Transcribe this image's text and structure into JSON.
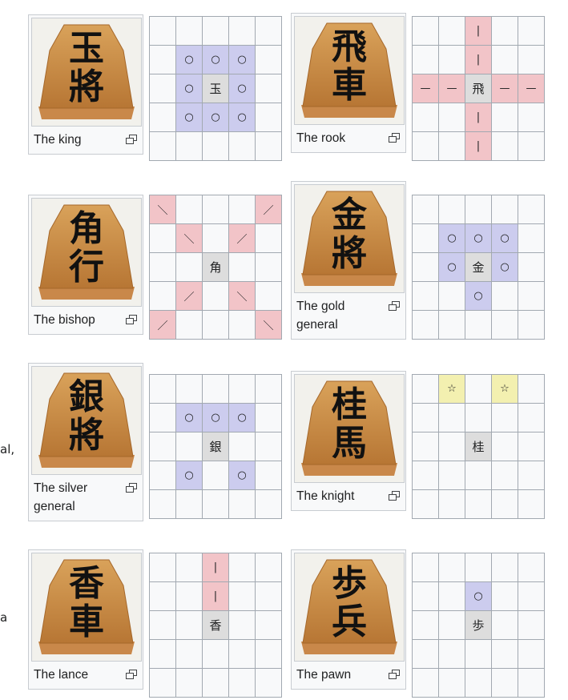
{
  "article_text_fragments": [
    {
      "id": "f1",
      "text": "al,"
    },
    {
      "id": "f2",
      "text": "a"
    }
  ],
  "colors": {
    "move_step": "#ccccee",
    "move_range": "#f2c4c8",
    "move_jump": "#f3f0b0",
    "piece_square": "#dddddd",
    "board_bg": "#f8f9fa",
    "grid_line": "#a2a9b1"
  },
  "icons": {
    "enlarge": "magnify-clip-icon"
  },
  "pieces": [
    {
      "key": "king",
      "caption": "The king",
      "kanji_top": "玉",
      "kanji_bottom": "將",
      "board": [
        {
          "row": 1,
          "col": 1,
          "mark": "○",
          "type": "blue"
        },
        {
          "row": 1,
          "col": 2,
          "mark": "○",
          "type": "blue"
        },
        {
          "row": 1,
          "col": 3,
          "mark": "○",
          "type": "blue"
        },
        {
          "row": 2,
          "col": 1,
          "mark": "○",
          "type": "blue"
        },
        {
          "row": 2,
          "col": 2,
          "mark": "玉",
          "type": "center"
        },
        {
          "row": 2,
          "col": 3,
          "mark": "○",
          "type": "blue"
        },
        {
          "row": 3,
          "col": 1,
          "mark": "○",
          "type": "blue"
        },
        {
          "row": 3,
          "col": 2,
          "mark": "○",
          "type": "blue"
        },
        {
          "row": 3,
          "col": 3,
          "mark": "○",
          "type": "blue"
        }
      ]
    },
    {
      "key": "rook",
      "caption": "The rook",
      "kanji_top": "飛",
      "kanji_bottom": "車",
      "board": [
        {
          "row": 0,
          "col": 2,
          "mark": "|",
          "type": "pink"
        },
        {
          "row": 1,
          "col": 2,
          "mark": "|",
          "type": "pink"
        },
        {
          "row": 2,
          "col": 0,
          "mark": "—",
          "type": "pink"
        },
        {
          "row": 2,
          "col": 1,
          "mark": "—",
          "type": "pink"
        },
        {
          "row": 2,
          "col": 2,
          "mark": "飛",
          "type": "center"
        },
        {
          "row": 2,
          "col": 3,
          "mark": "—",
          "type": "pink"
        },
        {
          "row": 2,
          "col": 4,
          "mark": "—",
          "type": "pink"
        },
        {
          "row": 3,
          "col": 2,
          "mark": "|",
          "type": "pink"
        },
        {
          "row": 4,
          "col": 2,
          "mark": "|",
          "type": "pink"
        }
      ]
    },
    {
      "key": "bishop",
      "caption": "The bishop",
      "kanji_top": "角",
      "kanji_bottom": "行",
      "board": [
        {
          "row": 0,
          "col": 0,
          "mark": "＼",
          "type": "pink"
        },
        {
          "row": 0,
          "col": 4,
          "mark": "／",
          "type": "pink"
        },
        {
          "row": 1,
          "col": 1,
          "mark": "＼",
          "type": "pink"
        },
        {
          "row": 1,
          "col": 3,
          "mark": "／",
          "type": "pink"
        },
        {
          "row": 2,
          "col": 2,
          "mark": "角",
          "type": "center"
        },
        {
          "row": 3,
          "col": 1,
          "mark": "／",
          "type": "pink"
        },
        {
          "row": 3,
          "col": 3,
          "mark": "＼",
          "type": "pink"
        },
        {
          "row": 4,
          "col": 0,
          "mark": "／",
          "type": "pink"
        },
        {
          "row": 4,
          "col": 4,
          "mark": "＼",
          "type": "pink"
        }
      ]
    },
    {
      "key": "gold",
      "caption": "The gold general",
      "kanji_top": "金",
      "kanji_bottom": "將",
      "board": [
        {
          "row": 1,
          "col": 1,
          "mark": "○",
          "type": "blue"
        },
        {
          "row": 1,
          "col": 2,
          "mark": "○",
          "type": "blue"
        },
        {
          "row": 1,
          "col": 3,
          "mark": "○",
          "type": "blue"
        },
        {
          "row": 2,
          "col": 1,
          "mark": "○",
          "type": "blue"
        },
        {
          "row": 2,
          "col": 2,
          "mark": "金",
          "type": "center"
        },
        {
          "row": 2,
          "col": 3,
          "mark": "○",
          "type": "blue"
        },
        {
          "row": 3,
          "col": 2,
          "mark": "○",
          "type": "blue"
        }
      ]
    },
    {
      "key": "silver",
      "caption": "The silver general",
      "kanji_top": "銀",
      "kanji_bottom": "將",
      "board": [
        {
          "row": 1,
          "col": 1,
          "mark": "○",
          "type": "blue"
        },
        {
          "row": 1,
          "col": 2,
          "mark": "○",
          "type": "blue"
        },
        {
          "row": 1,
          "col": 3,
          "mark": "○",
          "type": "blue"
        },
        {
          "row": 2,
          "col": 2,
          "mark": "銀",
          "type": "center"
        },
        {
          "row": 3,
          "col": 1,
          "mark": "○",
          "type": "blue"
        },
        {
          "row": 3,
          "col": 3,
          "mark": "○",
          "type": "blue"
        }
      ]
    },
    {
      "key": "knight",
      "caption": "The knight",
      "kanji_top": "桂",
      "kanji_bottom": "馬",
      "board": [
        {
          "row": 0,
          "col": 1,
          "mark": "☆",
          "type": "yellow"
        },
        {
          "row": 0,
          "col": 3,
          "mark": "☆",
          "type": "yellow"
        },
        {
          "row": 2,
          "col": 2,
          "mark": "桂",
          "type": "center"
        }
      ]
    },
    {
      "key": "lance",
      "caption": "The lance",
      "kanji_top": "香",
      "kanji_bottom": "車",
      "board": [
        {
          "row": 0,
          "col": 2,
          "mark": "|",
          "type": "pink"
        },
        {
          "row": 1,
          "col": 2,
          "mark": "|",
          "type": "pink"
        },
        {
          "row": 2,
          "col": 2,
          "mark": "香",
          "type": "center"
        }
      ]
    },
    {
      "key": "pawn",
      "caption": "The pawn",
      "kanji_top": "歩",
      "kanji_bottom": "兵",
      "board": [
        {
          "row": 1,
          "col": 2,
          "mark": "○",
          "type": "blue"
        },
        {
          "row": 2,
          "col": 2,
          "mark": "歩",
          "type": "center"
        }
      ]
    }
  ]
}
